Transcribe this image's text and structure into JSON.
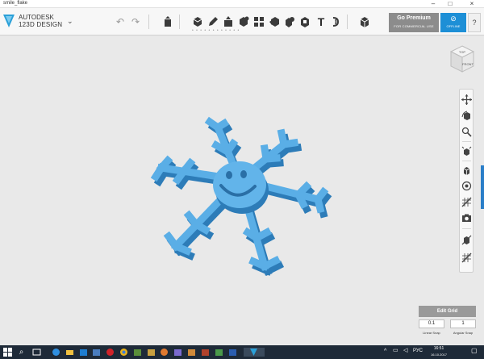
{
  "window": {
    "title": "smile_flake",
    "min_glyph": "–",
    "max_glyph": "□",
    "close_glyph": "×"
  },
  "app": {
    "logo_line1": "AUTODESK",
    "logo_line2": "123D DESIGN",
    "menu_glyph": "⌄"
  },
  "toolbar": {
    "undo_glyph": "↶",
    "redo_glyph": "↷",
    "text_tool_glyph": "T",
    "more_dots": "• • • • • • • • • • • •",
    "premium_label": "Go Premium",
    "premium_sub": "FOR COMMERCIAL USE",
    "offline_label": "OFFLINE",
    "help_label": "?"
  },
  "viewcube": {
    "top_label": "TOP",
    "front_label": "FRONT"
  },
  "grid_panel": {
    "title": "Edit Grid",
    "linear_snap_value": "0.1",
    "angular_snap_value": "1",
    "linear_snap_label": "Linear Snap",
    "angular_snap_label": "Angular Snap"
  },
  "taskbar": {
    "search_glyph": "⌕",
    "tray_caret": "^",
    "language": "РУС",
    "time": "16:51",
    "date": "16.10.2017",
    "notif_glyph": "▢"
  },
  "colors": {
    "model_blue": "#5aaee6",
    "model_dark": "#2d7cb8",
    "accent": "#1d8fd6",
    "canvas": "#e9e9e9"
  }
}
